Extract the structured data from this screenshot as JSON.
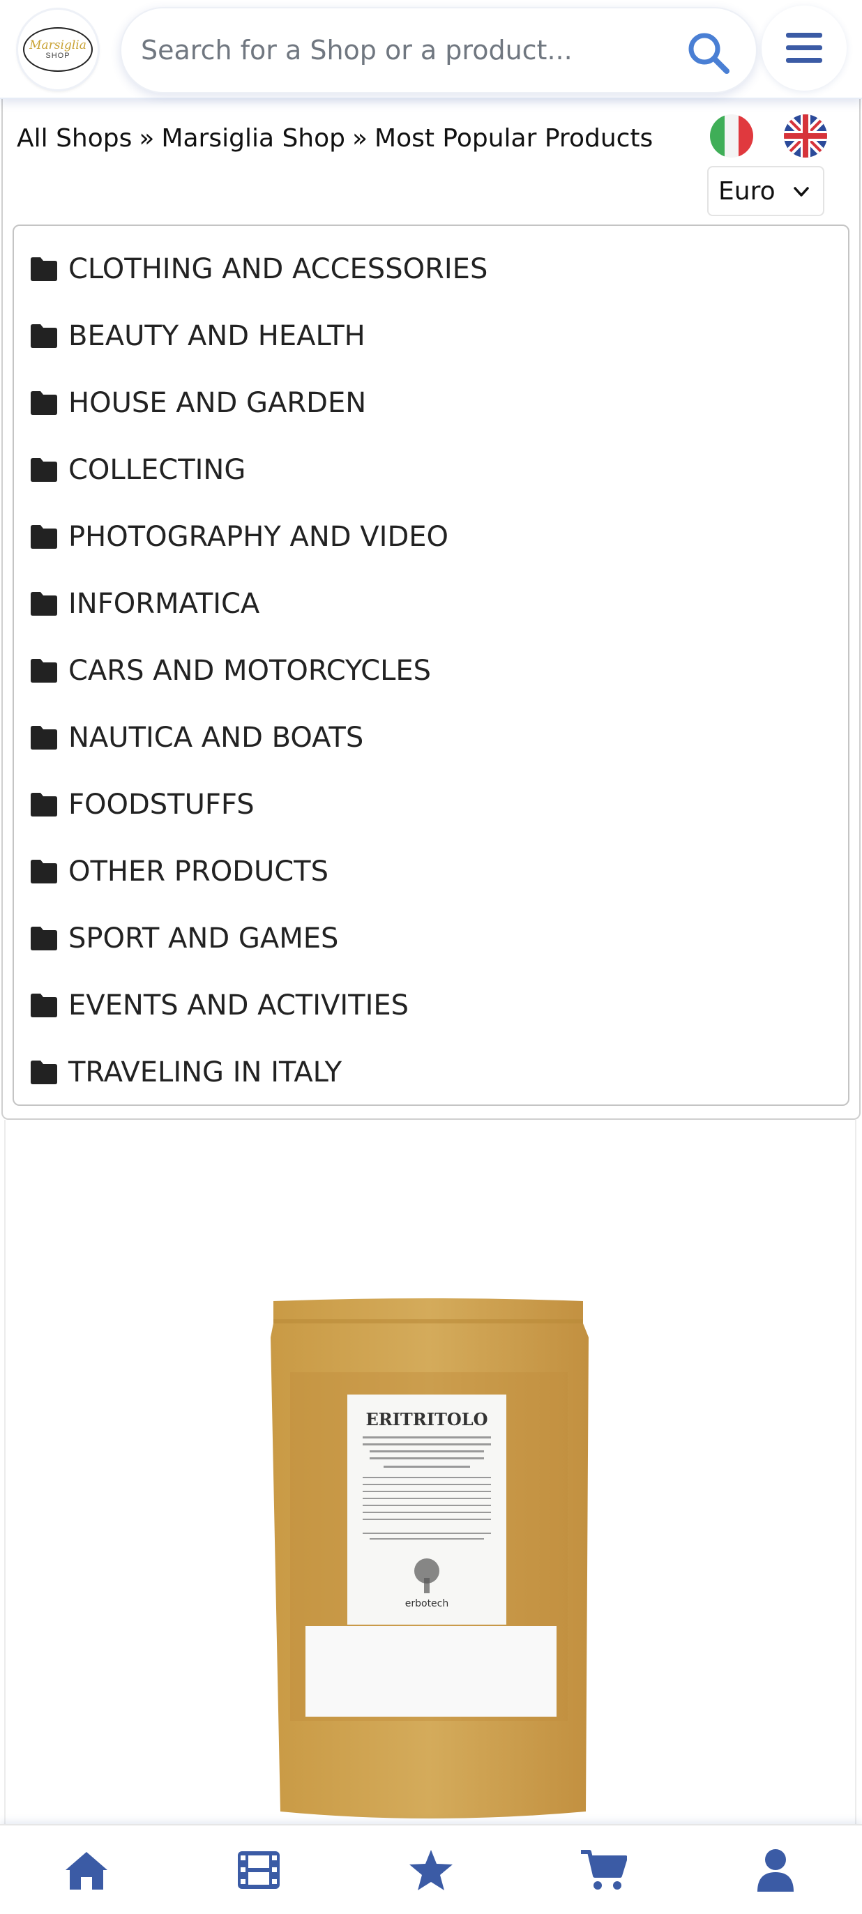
{
  "header": {
    "logo_text": "Marsiglia",
    "logo_sub": "SHOP",
    "search_placeholder": "Search for a Shop or a product..."
  },
  "breadcrumb": {
    "items": [
      "All Shops",
      "Marsiglia Shop",
      "Most Popular Products"
    ],
    "separator": "»"
  },
  "languages": [
    "Italian flag",
    "UK flag"
  ],
  "currency": {
    "selected": "Euro"
  },
  "categories": [
    "CLOTHING AND ACCESSORIES",
    "BEAUTY AND HEALTH",
    "HOUSE AND GARDEN",
    "COLLECTING",
    "PHOTOGRAPHY AND VIDEO",
    "INFORMATICA",
    "CARS AND MOTORCYCLES",
    "NAUTICA AND BOATS",
    "FOODSTUFFS",
    "OTHER PRODUCTS",
    "SPORT AND GAMES",
    "EVENTS AND ACTIVITIES",
    "TRAVELING IN ITALY"
  ],
  "product": {
    "label_title": "ERITRITOLO",
    "brand": "erbotech"
  },
  "bottom_nav": [
    "home-icon",
    "film-icon",
    "star-icon",
    "cart-icon",
    "user-icon"
  ],
  "colors": {
    "accent": "#3b5ba5",
    "search_icon": "#4a7fd4",
    "folder": "#222222",
    "kraft": "#c9a24e"
  }
}
